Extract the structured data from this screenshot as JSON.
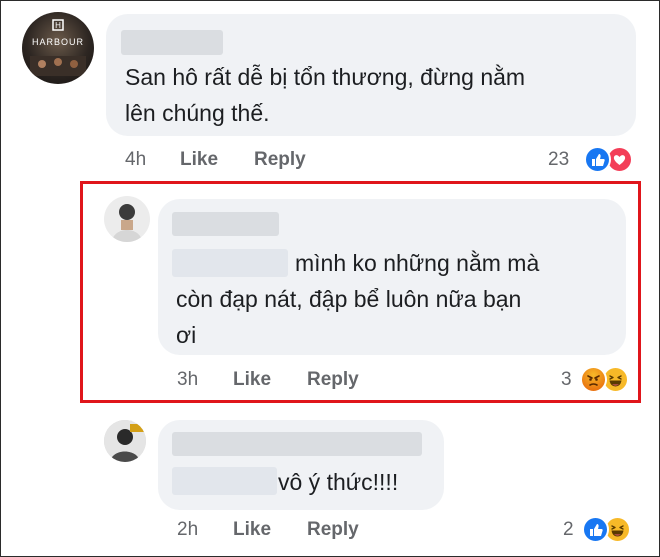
{
  "comments": [
    {
      "avatar_text": "HARBOUR",
      "text_lines": [
        "San hô rất dễ bị tổn thương, đừng nằm",
        "lên chúng thế."
      ],
      "time": "4h",
      "like_label": "Like",
      "reply_label": "Reply",
      "reaction_count": "23",
      "reactions": [
        "like",
        "love"
      ]
    },
    {
      "text_lines": [
        "mình ko những nằm mà",
        "còn đạp nát, đập bể luôn nữa bạn",
        "ơi"
      ],
      "time": "3h",
      "like_label": "Like",
      "reply_label": "Reply",
      "reaction_count": "3",
      "reactions": [
        "angry",
        "haha"
      ],
      "highlight_color": "#e0151b"
    },
    {
      "text_lines": [
        "vô ý thức!!!!"
      ],
      "time": "2h",
      "like_label": "Like",
      "reply_label": "Reply",
      "reaction_count": "2",
      "reactions": [
        "like",
        "haha"
      ]
    }
  ],
  "colors": {
    "bubble": "#f0f2f5",
    "meta": "#65676b",
    "like_blue": "#1877f2",
    "love_red": "#f33e58",
    "emoji_yellow": "#f7b928",
    "angry_orange": "#e9710f"
  }
}
